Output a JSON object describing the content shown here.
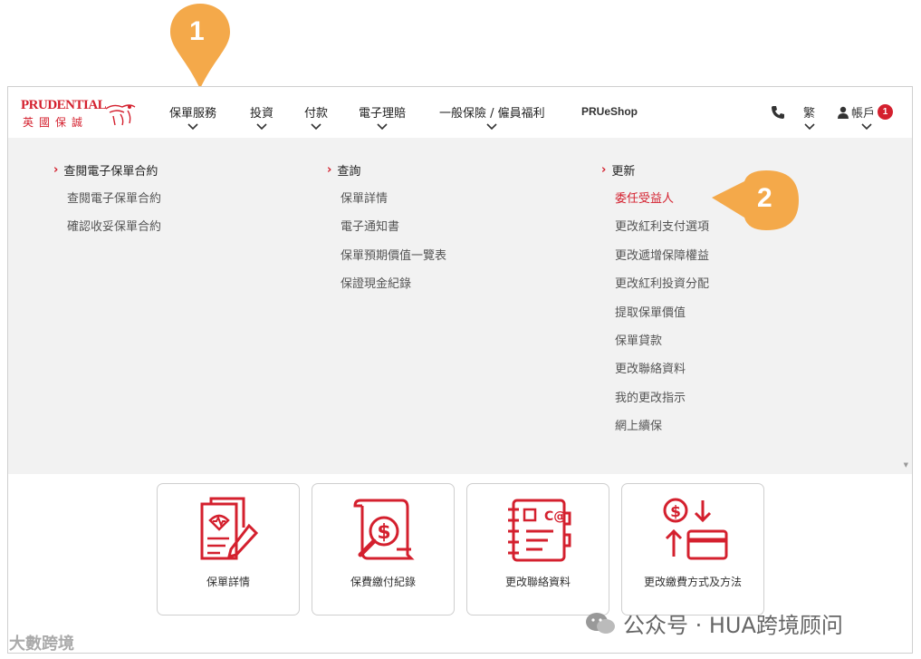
{
  "callouts": {
    "step1": "1",
    "step2": "2"
  },
  "brand": {
    "name_en": "PRUDENTIAL",
    "name_zh": "英國保誠",
    "color": "#d4202e"
  },
  "nav": {
    "items": [
      {
        "label": "保單服務"
      },
      {
        "label": "投資"
      },
      {
        "label": "付款"
      },
      {
        "label": "電子理賠"
      },
      {
        "label": "一般保險 / 僱員福利"
      }
    ],
    "shop": "PRUeShop",
    "phone_icon": "phone-icon",
    "language": "繁",
    "account": "帳戶",
    "account_badge": "1"
  },
  "menu": {
    "col1": {
      "heading": "查閱電子保單合約",
      "links": [
        "查閱電子保單合約",
        "確認收妥保單合約"
      ]
    },
    "col2": {
      "heading": "查詢",
      "links": [
        "保單詳情",
        "電子通知書",
        "保單預期價值一覽表",
        "保證現金紀錄"
      ]
    },
    "col3": {
      "heading": "更新",
      "links": [
        "委任受益人",
        "更改紅利支付選項",
        "更改遞增保障權益",
        "更改紅利投資分配",
        "提取保單價值",
        "保單貸款",
        "更改聯絡資料",
        "我的更改指示",
        "網上續保"
      ]
    }
  },
  "cards": [
    {
      "label": "保單詳情",
      "icon": "policy-document-icon"
    },
    {
      "label": "保費繳付紀錄",
      "icon": "payment-record-icon"
    },
    {
      "label": "更改聯絡資料",
      "icon": "contact-book-icon"
    },
    {
      "label": "更改繳費方式及方法",
      "icon": "payment-method-icon"
    }
  ],
  "watermarks": {
    "left": "大數跨境",
    "right": "公众号 · HUA跨境顾问"
  },
  "colors": {
    "accent": "#d4202e",
    "callout": "#f4a94a",
    "panel_bg": "#f2f2f2"
  }
}
